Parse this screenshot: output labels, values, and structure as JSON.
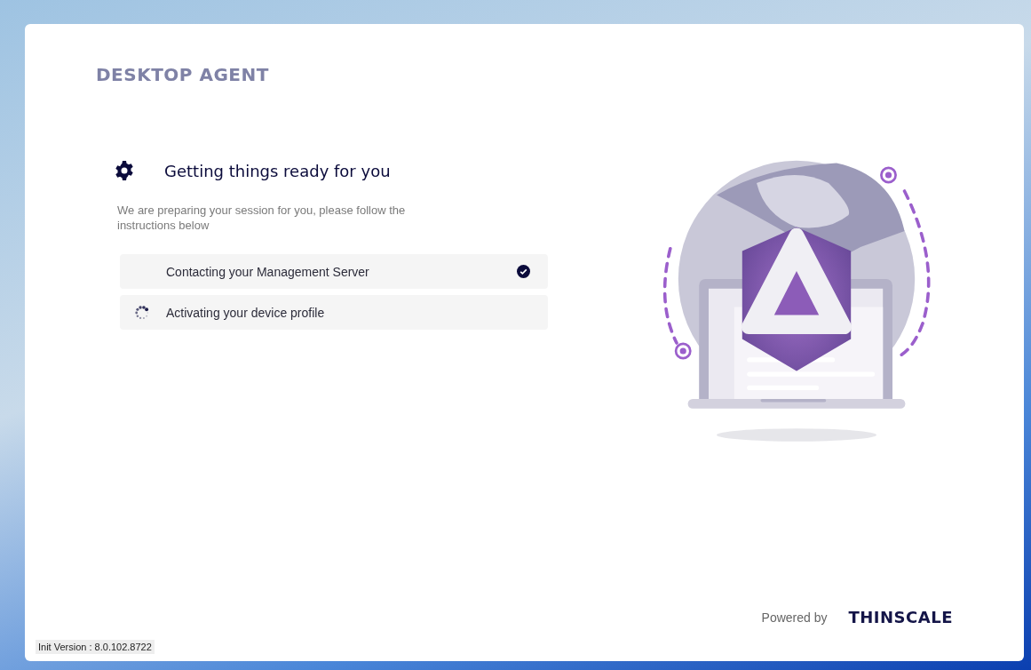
{
  "app_title": "DESKTOP AGENT",
  "heading": "Getting things ready for you",
  "description": "We are preparing your session for you, please follow the instructions below",
  "steps": [
    {
      "label": "Contacting your Management Server",
      "kind": "done"
    },
    {
      "label": "Activating your device profile",
      "kind": "loading"
    }
  ],
  "powered_by": "Powered by",
  "brand": "THINSCALE",
  "version": "Init Version : 8.0.102.8722"
}
